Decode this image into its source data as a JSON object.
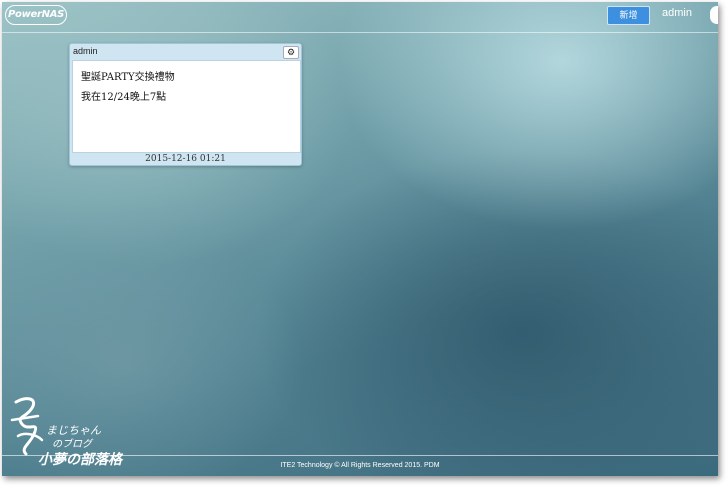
{
  "app": {
    "logo_text": "PowerNAS"
  },
  "topbar": {
    "add_button_label": "新增",
    "user_name": "admin"
  },
  "note": {
    "author": "admin",
    "lines": [
      "聖誕PARTY交換禮物",
      "我在12/24晚上7點"
    ],
    "date": "2015-12-16 01:21",
    "settings_icon": "gear-icon"
  },
  "footer": {
    "copyright": "ITE2 Technology © All Rights Reserved 2015. PDM"
  },
  "watermark": {
    "text": "夢 まじちゃんのブログ 小夢の部落格"
  }
}
